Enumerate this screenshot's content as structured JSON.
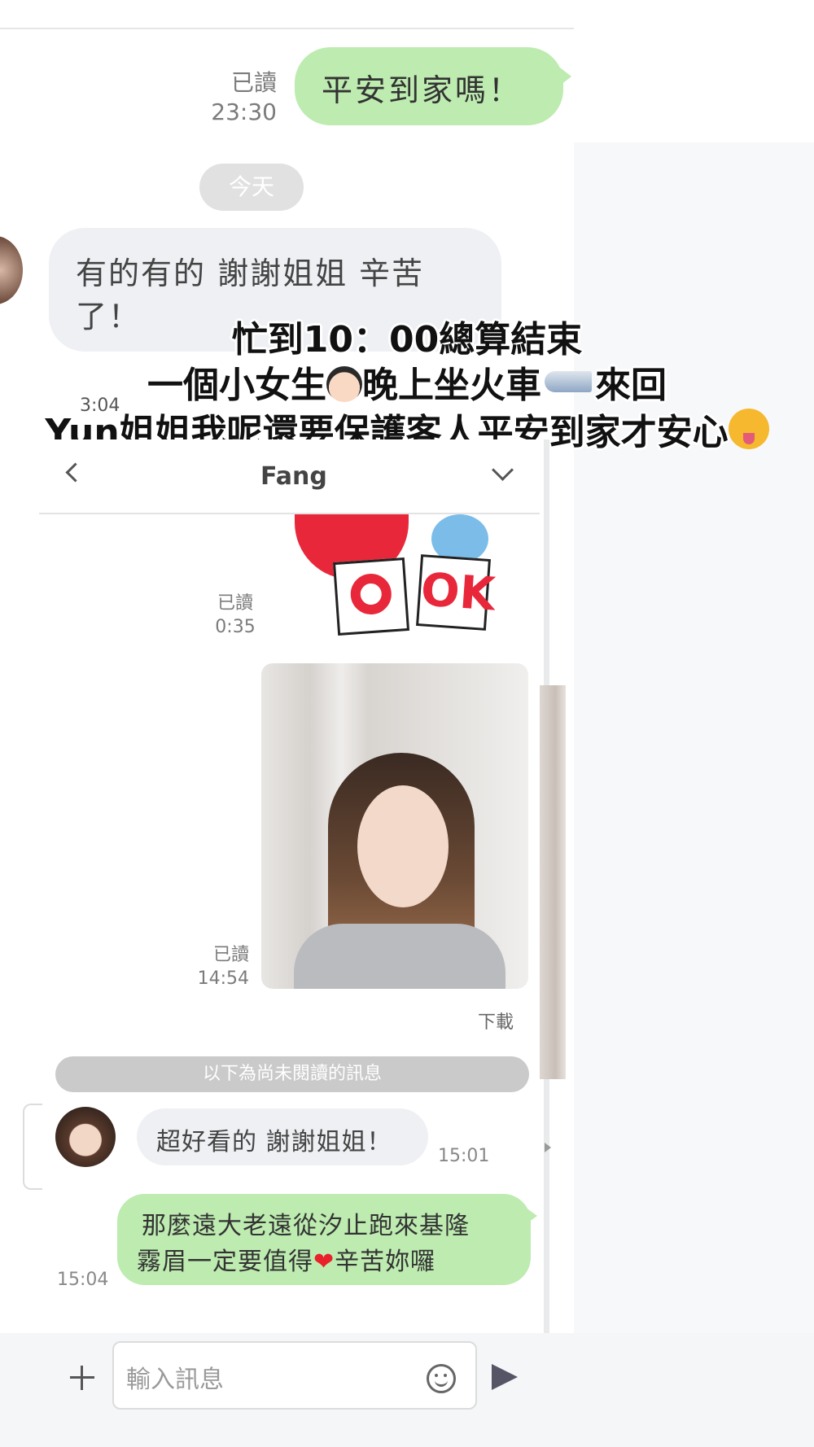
{
  "top_chat": {
    "read_label": "已讀",
    "time1": "23:30",
    "bubble1": "平安到家嗎！",
    "date_divider": "今天",
    "reply": "有的有的 謝謝姐姐 辛苦了！",
    "reply_line1": "有的有的 謝謝姐姐 辛苦",
    "reply_line2": "了！",
    "reply_time": "3:04"
  },
  "caption": {
    "line1": "忙到10：00總算結束",
    "line2a": "一個小女生",
    "line2b": "晚上坐火車",
    "line2c": "來回",
    "line3a": "Yun姐姐我呢還要保護客人平安到家才安心"
  },
  "chat2": {
    "header_title": "Fang",
    "sticker_read": "已讀",
    "sticker_time": "0:35",
    "sticker_letters": "OK",
    "photo_read": "已讀",
    "photo_time": "14:54",
    "download_label": "下載",
    "unread_divider": "以下為尚未閱讀的訊息",
    "incoming_text": "超好看的 謝謝姐姐！",
    "incoming_time": "15:01",
    "outgoing_line1": "那麼遠大老遠從汐止跑來基隆",
    "outgoing_line2a": "霧眉一定要值得",
    "outgoing_line2b": "辛苦妳囉",
    "outgoing_time": "15:04",
    "input_placeholder": "輸入訊息"
  },
  "colors": {
    "outgoing_bubble": "#bdebb0",
    "incoming_bubble": "#eef0f3",
    "heart": "#e8212b"
  }
}
